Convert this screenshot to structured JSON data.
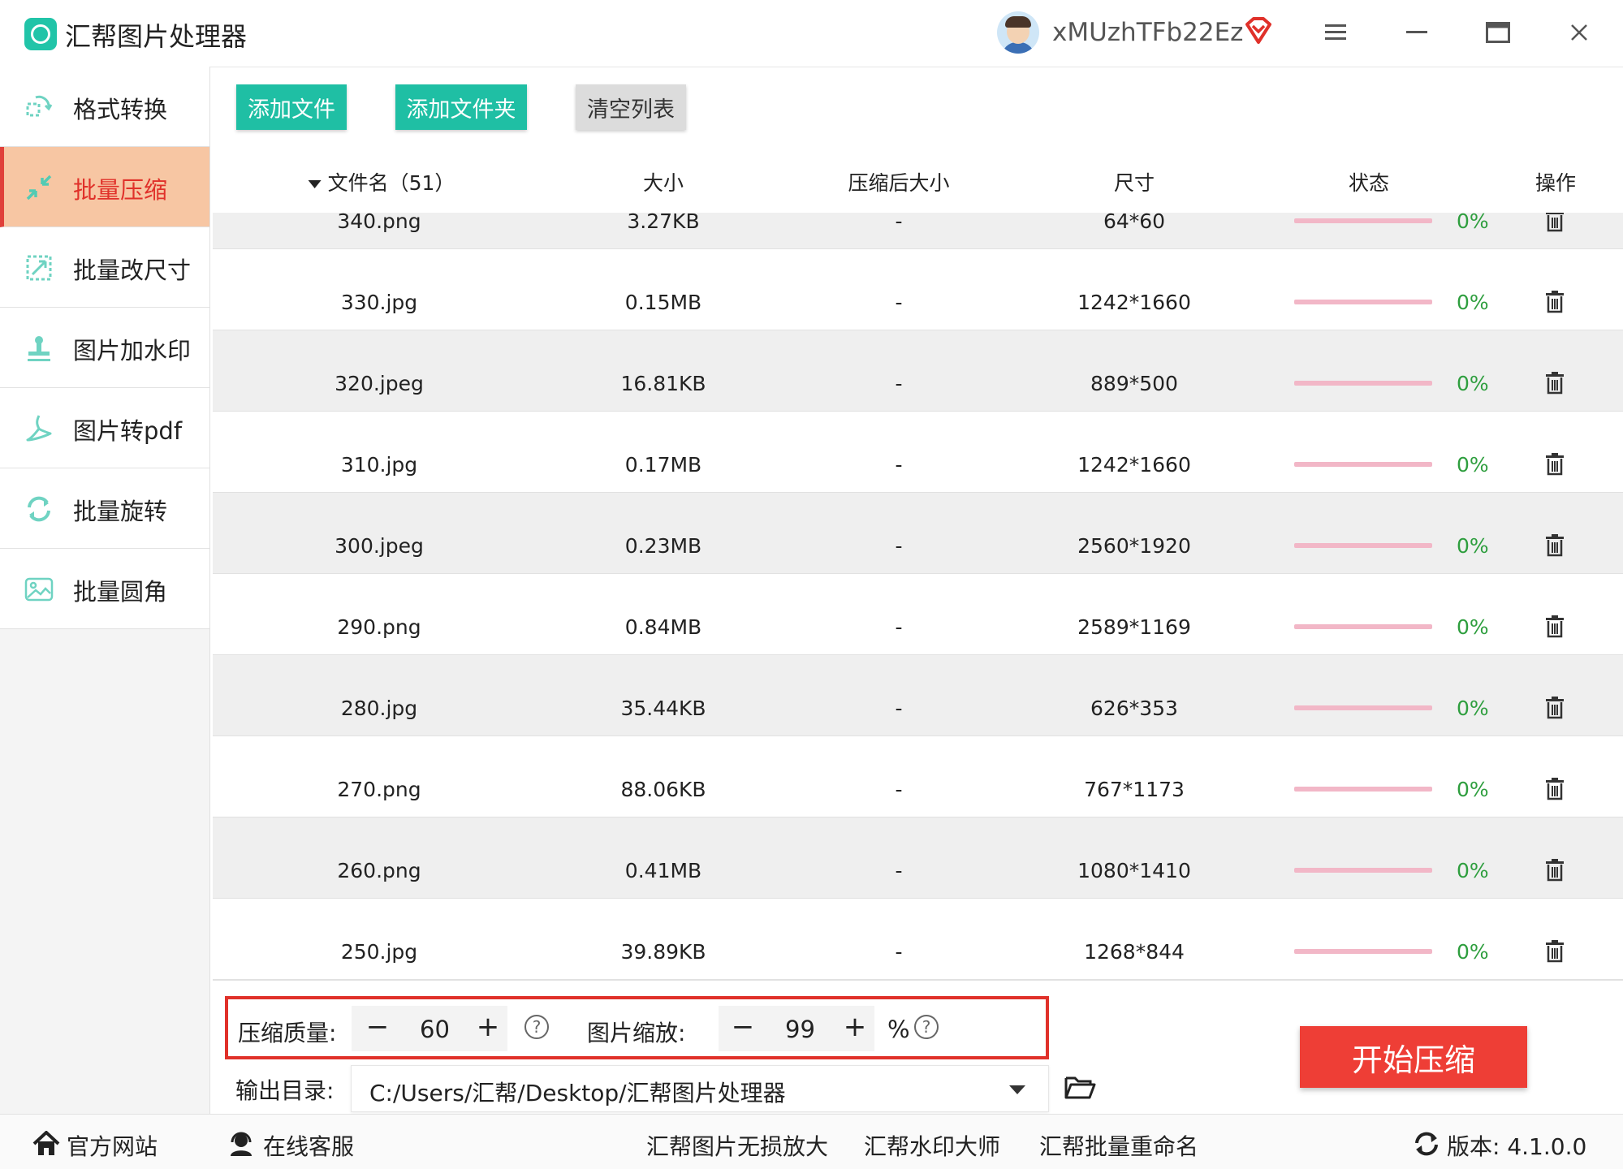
{
  "app": {
    "title": "汇帮图片处理器",
    "username": "xMUzhTFb22Ez"
  },
  "colors": {
    "accent_teal": "#1fbfa4",
    "active_sidebar_bg": "#f7c6a3",
    "active_text": "#e0312a",
    "start_button": "#ee3e36",
    "progress_bar": "#f2b7c7",
    "status_green": "#2e9e3e"
  },
  "sidebar": {
    "items": [
      {
        "label": "格式转换",
        "icon": "convert-icon"
      },
      {
        "label": "批量压缩",
        "icon": "compress-icon",
        "active": true
      },
      {
        "label": "批量改尺寸",
        "icon": "resize-icon"
      },
      {
        "label": "图片加水印",
        "icon": "watermark-icon"
      },
      {
        "label": "图片转pdf",
        "icon": "pdf-icon"
      },
      {
        "label": "批量旋转",
        "icon": "rotate-icon"
      },
      {
        "label": "批量圆角",
        "icon": "rounded-corner-icon"
      }
    ]
  },
  "toolbar": {
    "add_file": "添加文件",
    "add_folder": "添加文件夹",
    "clear_list": "清空列表"
  },
  "table": {
    "headers": {
      "filename": "文件名（51）",
      "size": "大小",
      "compressed_size": "压缩后大小",
      "dimensions": "尺寸",
      "status": "状态",
      "actions": "操作"
    },
    "rows": [
      {
        "name": "340.png",
        "size": "3.27KB",
        "compressed": "-",
        "dims": "64*60",
        "progress": "0%"
      },
      {
        "name": "330.jpg",
        "size": "0.15MB",
        "compressed": "-",
        "dims": "1242*1660",
        "progress": "0%"
      },
      {
        "name": "320.jpeg",
        "size": "16.81KB",
        "compressed": "-",
        "dims": "889*500",
        "progress": "0%"
      },
      {
        "name": "310.jpg",
        "size": "0.17MB",
        "compressed": "-",
        "dims": "1242*1660",
        "progress": "0%"
      },
      {
        "name": "300.jpeg",
        "size": "0.23MB",
        "compressed": "-",
        "dims": "2560*1920",
        "progress": "0%"
      },
      {
        "name": "290.png",
        "size": "0.84MB",
        "compressed": "-",
        "dims": "2589*1169",
        "progress": "0%"
      },
      {
        "name": "280.jpg",
        "size": "35.44KB",
        "compressed": "-",
        "dims": "626*353",
        "progress": "0%"
      },
      {
        "name": "270.png",
        "size": "88.06KB",
        "compressed": "-",
        "dims": "767*1173",
        "progress": "0%"
      },
      {
        "name": "260.png",
        "size": "0.41MB",
        "compressed": "-",
        "dims": "1080*1410",
        "progress": "0%"
      },
      {
        "name": "250.jpg",
        "size": "39.89KB",
        "compressed": "-",
        "dims": "1268*844",
        "progress": "0%"
      }
    ]
  },
  "settings": {
    "quality_label": "压缩质量:",
    "quality_value": "60",
    "scale_label": "图片缩放:",
    "scale_value": "99",
    "scale_unit": "%",
    "minus": "−",
    "plus": "+",
    "output_label": "输出目录:",
    "output_path": "C:/Users/汇帮/Desktop/汇帮图片处理器"
  },
  "start_button": "开始压缩",
  "footer": {
    "website": "官方网站",
    "support": "在线客服",
    "link1": "汇帮图片无损放大",
    "link2": "汇帮水印大师",
    "link3": "汇帮批量重命名",
    "version": "版本:  4.1.0.0"
  }
}
